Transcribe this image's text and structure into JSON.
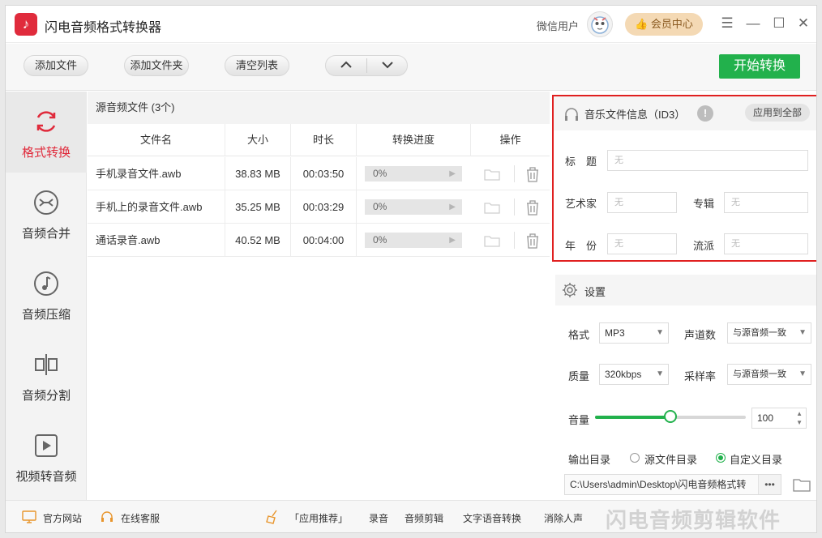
{
  "app": {
    "title": "闪电音频格式转换器",
    "logo_glyph": "♪",
    "user_name": "微信用户",
    "vip_label": "会员中心",
    "vip_icon": "thumb-icon"
  },
  "window_controls": {
    "menu": "☰",
    "minimize": "—",
    "maximize": "☐",
    "close": "✕"
  },
  "toolbar": {
    "add_file": "添加文件",
    "add_folder": "添加文件夹",
    "clear_list": "清空列表",
    "move_up": "∧",
    "move_down": "∨",
    "start": "开始转换"
  },
  "sidebar": {
    "items": [
      {
        "label": "格式转换",
        "icon": "refresh-icon",
        "active": true
      },
      {
        "label": "音频合并",
        "icon": "merge-icon",
        "active": false
      },
      {
        "label": "音频压缩",
        "icon": "music-note-icon",
        "active": false
      },
      {
        "label": "音频分割",
        "icon": "split-icon",
        "active": false
      },
      {
        "label": "视频转音频",
        "icon": "video-play-icon",
        "active": false
      }
    ]
  },
  "file_list": {
    "caption": "源音频文件 (3个)",
    "columns": [
      "文件名",
      "大小",
      "时长",
      "转换进度",
      "操作"
    ],
    "rows": [
      {
        "name": "手机录音文件.awb",
        "size": "38.83 MB",
        "duration": "00:03:50",
        "progress": "0%"
      },
      {
        "name": "手机上的录音文件.awb",
        "size": "35.25 MB",
        "duration": "00:03:29",
        "progress": "0%"
      },
      {
        "name": "通话录音.awb",
        "size": "40.52 MB",
        "duration": "00:04:00",
        "progress": "0%"
      }
    ]
  },
  "id3": {
    "title": "音乐文件信息（ID3）",
    "apply_all": "应用到全部",
    "fields": {
      "title_label": "标　题",
      "artist_label": "艺术家",
      "album_label": "专辑",
      "year_label": "年　份",
      "genre_label": "流派",
      "placeholder": "无"
    }
  },
  "settings": {
    "title": "设置",
    "format_label": "格式",
    "format_value": "MP3",
    "channels_label": "声道数",
    "channels_value": "与源音频一致",
    "quality_label": "质量",
    "quality_value": "320kbps",
    "samplerate_label": "采样率",
    "samplerate_value": "与源音频一致",
    "volume_label": "音量",
    "volume_value": "100",
    "volume_level_fraction": 0.5,
    "output_label": "输出目录",
    "output_option_source": "源文件目录",
    "output_option_custom": "自定义目录",
    "output_selected": "custom",
    "output_path": "C:\\Users\\admin\\Desktop\\闪电音频格式转",
    "browse_dots": "•••"
  },
  "footer": {
    "website": "官方网站",
    "support": "在线客服",
    "recommend": "「应用推荐」",
    "links": [
      "录音",
      "音频剪辑",
      "文字语音转换",
      "消除人声"
    ],
    "watermark": "闪电音频剪辑软件"
  },
  "colors": {
    "accent_green": "#22b14c",
    "brand_red": "#e02b3c",
    "highlight_red": "#e02020",
    "vip_gold": "#f4d9b4"
  }
}
